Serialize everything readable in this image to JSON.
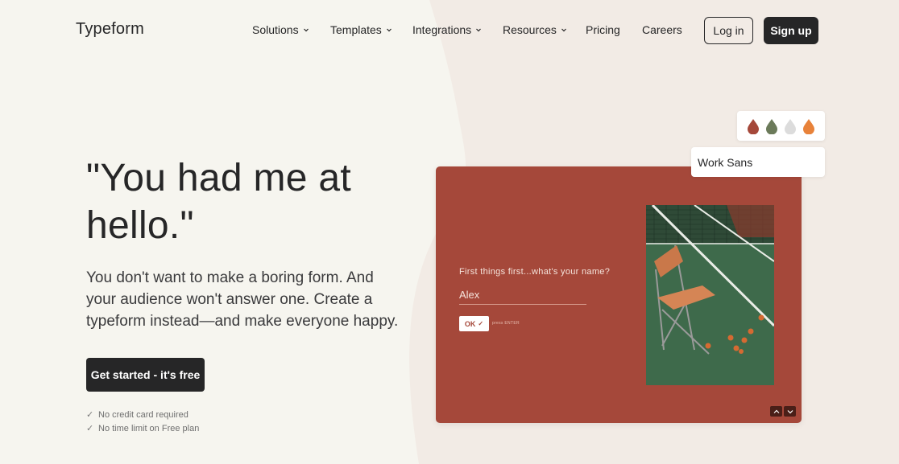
{
  "brand": {
    "logo": "Typeform"
  },
  "nav": {
    "items": [
      {
        "label": "Solutions",
        "dropdown": true
      },
      {
        "label": "Templates",
        "dropdown": true
      },
      {
        "label": "Integrations",
        "dropdown": true
      },
      {
        "label": "Resources",
        "dropdown": true
      },
      {
        "label": "Pricing",
        "dropdown": false
      },
      {
        "label": "Careers",
        "dropdown": false
      }
    ],
    "login_label": "Log in",
    "signup_label": "Sign up"
  },
  "hero": {
    "headline_line1": "\"You had me at",
    "headline_line2": "hello.\"",
    "subtitle": "You don't want to make a boring form. And your audience won't answer one. Create a typeform instead—and make everyone happy.",
    "cta_label": "Get started - it's free",
    "checks": [
      "No credit card required",
      "No time limit on Free plan"
    ]
  },
  "preview": {
    "question": "First things first...what's your name?",
    "answer": "Alex",
    "ok_label": "OK",
    "press_enter": "press ENTER",
    "font_name": "Work Sans",
    "palette": [
      "#a5483a",
      "#6b7a5a",
      "#dcdcdc",
      "#e8823a"
    ]
  },
  "colors": {
    "background": "#f2ebe5",
    "left_panel": "#f6f4ef",
    "text": "#262627",
    "form_bg": "#a5483a"
  }
}
